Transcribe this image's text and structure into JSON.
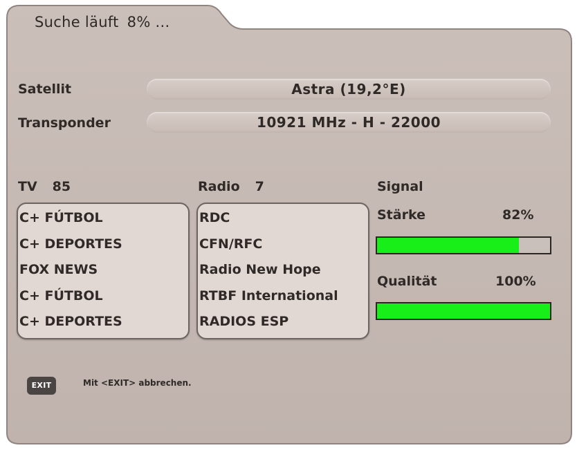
{
  "header": {
    "title": "Suche läuft",
    "progress": "8% ..."
  },
  "transponder_info": {
    "satellite_label": "Satellit",
    "satellite_value": "Astra (19,2°E)",
    "transponder_label": "Transponder",
    "transponder_value": "10921 MHz - H - 22000"
  },
  "tv": {
    "label": "TV",
    "count": "85",
    "channels": [
      "C+ FÚTBOL",
      "C+ DEPORTES",
      "FOX NEWS",
      "C+ FÚTBOL",
      "C+ DEPORTES"
    ]
  },
  "radio": {
    "label": "Radio",
    "count": "7",
    "channels": [
      "RDC",
      "CFN/RFC",
      "Radio New Hope",
      "RTBF International",
      "RADIOS ESP"
    ]
  },
  "signal": {
    "label": "Signal",
    "strength_label": "Stärke",
    "strength_value": "82%",
    "strength_fraction": 0.82,
    "quality_label": "Qualität",
    "quality_value": "100%",
    "quality_fraction": 1.0
  },
  "footer": {
    "exit_key": "EXIT",
    "hint": "Mit <EXIT> abbrechen."
  },
  "colors": {
    "panel": "#c5b8b2",
    "bar_fill": "#18ee18"
  }
}
